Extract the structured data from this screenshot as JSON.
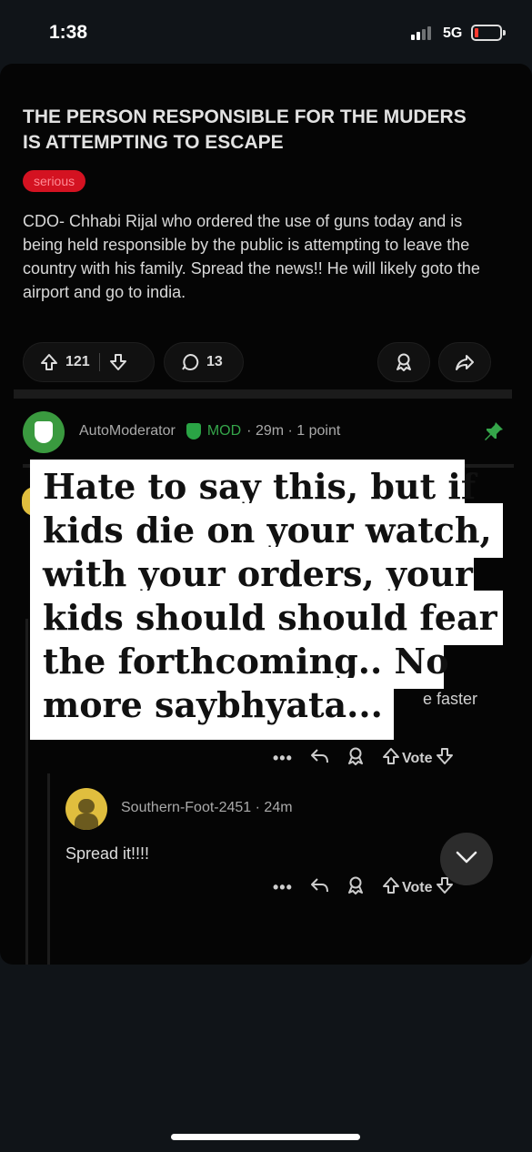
{
  "status_bar": {
    "time": "1:38",
    "network": "5G"
  },
  "post": {
    "title": "THE PERSON RESPONSIBLE FOR THE MUDERS IS ATTEMPTING TO ESCAPE",
    "flair": "serious",
    "body": "CDO- Chhabi Rijal who ordered the use of guns today and is being held responsible by the public is attempting to leave the country with his family. Spread the news!! He will likely goto the airport and go to india.",
    "upvotes": "121",
    "comments": "13"
  },
  "automoderator": {
    "name": "AutoModerator",
    "badge": "MOD",
    "meta": "· 29m · 1 point"
  },
  "hidden_comment": {
    "fragment": "e faster",
    "vote_label": "Vote",
    "more": "•••"
  },
  "reply": {
    "author": "Southern-Foot-2451",
    "time": "· 24m",
    "text": "Spread it!!!!",
    "vote_label": "Vote",
    "more": "•••"
  },
  "caption": {
    "lines": [
      "Hate to say this, but if",
      "kids die on your watch,",
      "with your orders, your",
      "kids should should fear",
      "the forthcoming.. No",
      "more saybhyata..."
    ]
  },
  "colors": {
    "flair_bg": "#d41221",
    "mod_green": "#35a54a",
    "battery_low": "#ff3b30",
    "avatar_yellow": "#e0be3e"
  }
}
